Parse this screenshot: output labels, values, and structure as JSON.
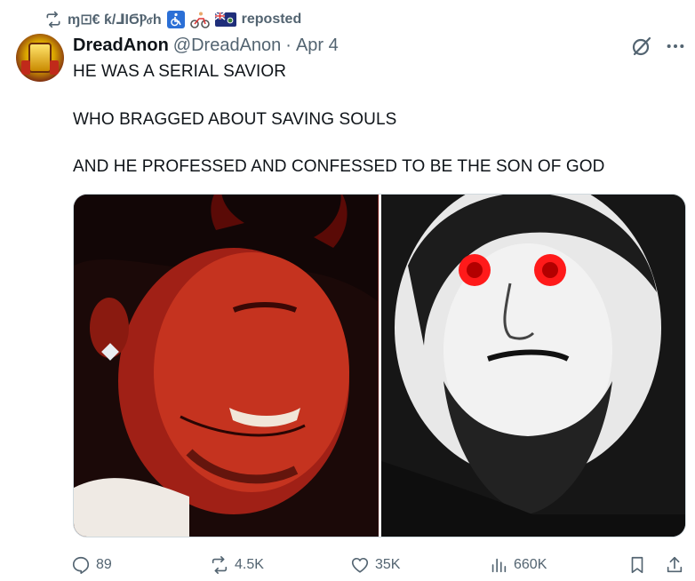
{
  "repost": {
    "name": "ɱ⊡€ ƙ/⅃ΙϬⲢⳝh",
    "label": "reposted"
  },
  "post": {
    "display_name": "DreadAnon",
    "handle": "@DreadAnon",
    "separator": "·",
    "date": "Apr 4",
    "lines": [
      "HE WAS A SERIAL SAVIOR",
      "WHO BRAGGED ABOUT SAVING SOULS",
      "AND HE PROFESSED AND CONFESSED TO BE THE SON OF GOD"
    ]
  },
  "actions": {
    "replies": "89",
    "reposts": "4.5K",
    "likes": "35K",
    "views": "660K"
  },
  "icons": {
    "repost": "repost-icon",
    "grok": "grok-icon",
    "more": "more-icon",
    "reply": "reply-icon",
    "like": "heart-icon",
    "views": "views-icon",
    "bookmark": "bookmark-icon",
    "share": "share-icon"
  },
  "colors": {
    "text": "#0f1419",
    "secondary": "#536471",
    "border": "#cfd9de",
    "eye_red": "#ff1a1a"
  }
}
